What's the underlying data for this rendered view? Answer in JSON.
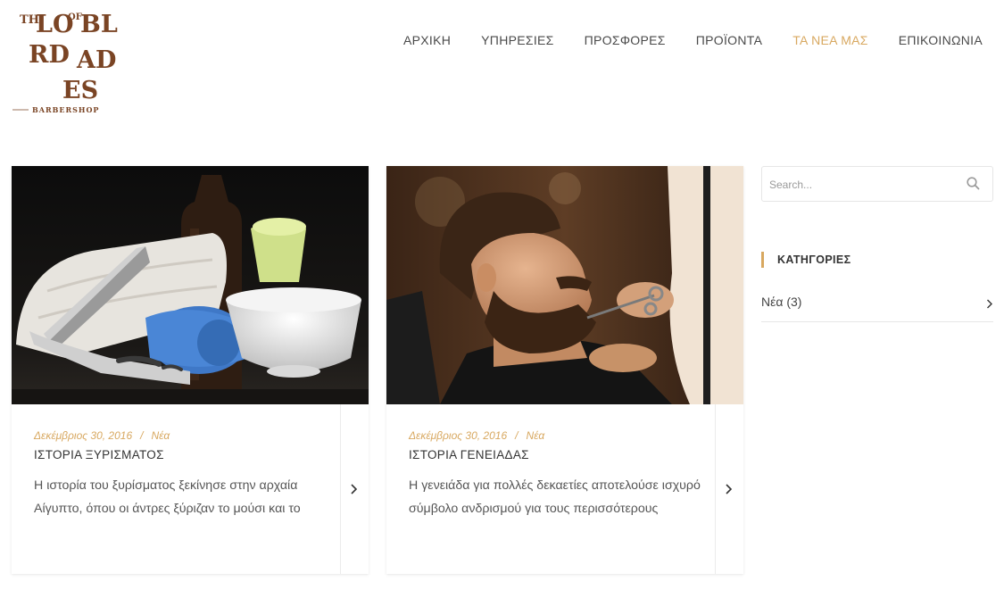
{
  "brand": {
    "logo_letters": [
      "TH",
      "LO",
      "OF",
      "BL",
      "RD",
      "AD",
      "ES"
    ],
    "logo_tagline": "BARBERSHOP",
    "logo_color": "#7a4424"
  },
  "nav": {
    "items": [
      {
        "label": "ΑΡΧΙΚΗ"
      },
      {
        "label": "ΥΠΗΡΕΣΙΕΣ"
      },
      {
        "label": "ΠΡΟΣΦΟΡΕΣ"
      },
      {
        "label": "ΠΡΟΪΟΝΤΑ"
      },
      {
        "label": "ΤΑ ΝΕΑ ΜΑΣ",
        "active": true
      },
      {
        "label": "ΕΠΙΚΟΙΝΩΝΙΑ"
      }
    ],
    "active_color": "#d8a860"
  },
  "posts": [
    {
      "date": "Δεκέμβριος 30, 2016",
      "separator": "/",
      "category": "Νέα",
      "title": "ΙΣΤΟΡΙΑ ΞΥΡΙΣΜΑΤΟΣ",
      "excerpt": "Η ιστορία του ξυρίσματος ξεκίνησε στην αρχαία Αίγυπτο, όπου οι άντρες ξύριζαν το μούσι και το",
      "image_icon": "shaving-kit-photo",
      "more_icon": "chevron-right-icon"
    },
    {
      "date": "Δεκέμβριος 30, 2016",
      "separator": "/",
      "category": "Νέα",
      "title": "ΙΣΤΟΡΙΑ ΓΕΝΕΙΑΔΑΣ",
      "excerpt": "Η γενειάδα για πολλές δεκαετίες αποτελούσε ισχυρό σύμβολο ανδρισμού για τους περισσότερους",
      "image_icon": "beard-trim-photo",
      "more_icon": "chevron-right-icon"
    }
  ],
  "sidebar": {
    "search": {
      "placeholder": "Search...",
      "value": "",
      "icon": "search-icon"
    },
    "categories": {
      "title": "ΚΑΤΗΓΟΡΙΕΣ",
      "items": [
        {
          "label": "Νέα (3)"
        }
      ]
    }
  },
  "colors": {
    "accent": "#d8a860",
    "text": "#333333"
  }
}
